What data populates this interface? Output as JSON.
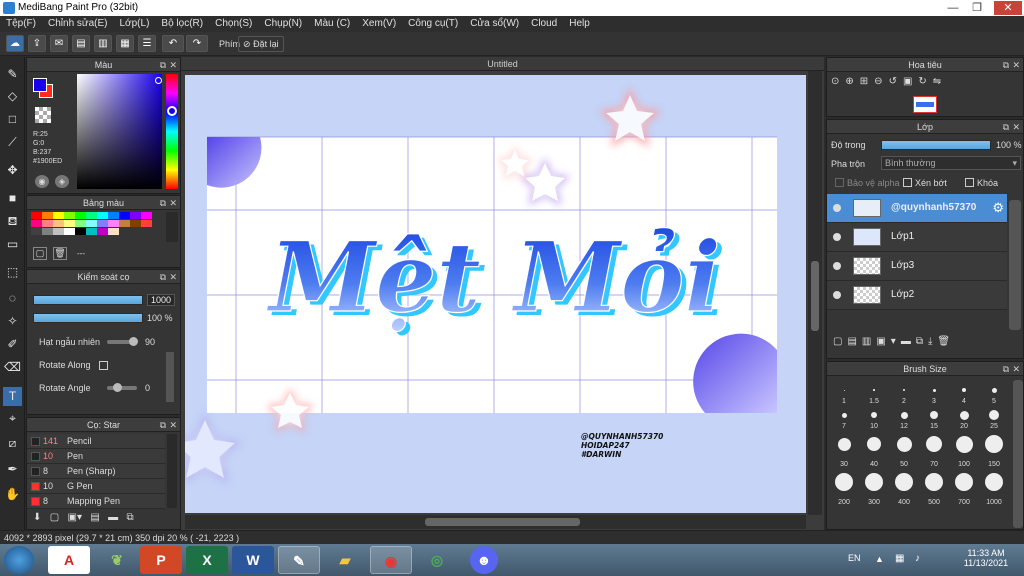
{
  "window": {
    "title": "MediBang Paint Pro (32bit)",
    "controls": [
      "—",
      "❐",
      "✕"
    ]
  },
  "menu": [
    "Tệp(F)",
    "Chỉnh sửa(E)",
    "Lớp(L)",
    "Bộ lọc(R)",
    "Chọn(S)",
    "Chụp(N)",
    "Màu (C)",
    "Xem(V)",
    "Công cụ(T)",
    "Cửa sổ(W)",
    "Cloud",
    "Help"
  ],
  "toolbar": {
    "shortcut_label": "Phím",
    "reset_label": "Đặt lại"
  },
  "color_panel": {
    "title": "Màu",
    "r": "R:25",
    "g": "G:0",
    "b": "B:237",
    "hex": "#1900ED",
    "fg_color": "#1900ED",
    "bg_color": "#ff2a1a"
  },
  "palette_panel": {
    "title": "Bảng màu",
    "more": "---",
    "swatches": [
      "#ff0000",
      "#ff8000",
      "#ffff00",
      "#80ff00",
      "#00ff00",
      "#00ff80",
      "#00ffff",
      "#0080ff",
      "#0000ff",
      "#8000ff",
      "#ff00ff",
      "#ff0080",
      "#ff8080",
      "#ffc080",
      "#ffff80",
      "#80ff80",
      "#80ffff",
      "#8080ff",
      "#ff80ff",
      "#c08040",
      "#804000",
      "#ff4040",
      "#404040",
      "#808080",
      "#c0c0c0",
      "#ffffff",
      "#000000",
      "#00c0c0",
      "#c000c0",
      "#ffe0c0"
    ]
  },
  "brush_control": {
    "title": "Kiểm soát cọ",
    "size_value": "1000",
    "opacity_value": "100 %",
    "jitter_label": "Hạt ngẫu nhiên",
    "jitter_value": "90",
    "rotate_along_label": "Rotate Along",
    "rotate_angle_label": "Rotate Angle",
    "rotate_angle_value": "0"
  },
  "brush_list": {
    "title": "Cọ: Star",
    "items": [
      {
        "num": "141",
        "name": "Pencil",
        "color": "#222222",
        "num_color": "#ff8080"
      },
      {
        "num": "10",
        "name": "Pen",
        "color": "#222222",
        "num_color": "#ff8080"
      },
      {
        "num": "8",
        "name": "Pen (Sharp)",
        "color": "#222222",
        "num_color": "#dddddd"
      },
      {
        "num": "10",
        "name": "G Pen",
        "color": "#ff3030",
        "num_color": "#dddddd"
      },
      {
        "num": "8",
        "name": "Mapping Pen",
        "color": "#ff3030",
        "num_color": "#dddddd"
      }
    ]
  },
  "canvas": {
    "tab_title": "Untitled",
    "main_text": "Mệt Mỏi",
    "credit_lines": [
      "@QUYNHANH57370",
      "HOIDAP247",
      "#DARWIN"
    ]
  },
  "navigator": {
    "title": "Hoa tiêu"
  },
  "layer_panel": {
    "title": "Lớp",
    "opacity_label": "Độ trong",
    "opacity_value": "100 %",
    "blend_label": "Pha trộn",
    "blend_value": "Bình thường",
    "alpha_label": "Bảo vệ alpha",
    "clip_label": "Xén bớt",
    "lock_label": "Khóa",
    "layers": [
      {
        "name": "@quynhanh57370",
        "active": true
      },
      {
        "name": "Lớp1",
        "active": false
      },
      {
        "name": "Lớp3",
        "active": false
      },
      {
        "name": "Lớp2",
        "active": false
      }
    ]
  },
  "brush_size": {
    "title": "Brush Size",
    "sizes": [
      "1",
      "1.5",
      "2",
      "3",
      "4",
      "5",
      "7",
      "10",
      "12",
      "15",
      "20",
      "25",
      "30",
      "40",
      "50",
      "70",
      "100",
      "150",
      "200",
      "300",
      "400",
      "500",
      "700",
      "1000"
    ]
  },
  "status": {
    "text": "4092 * 2893 pixel   (29.7 * 21 cm)   350 dpi   20 %   ( -21, 2223 )"
  },
  "taskbar": {
    "lang": "EN",
    "time": "11:33 AM",
    "date": "11/13/2021"
  }
}
